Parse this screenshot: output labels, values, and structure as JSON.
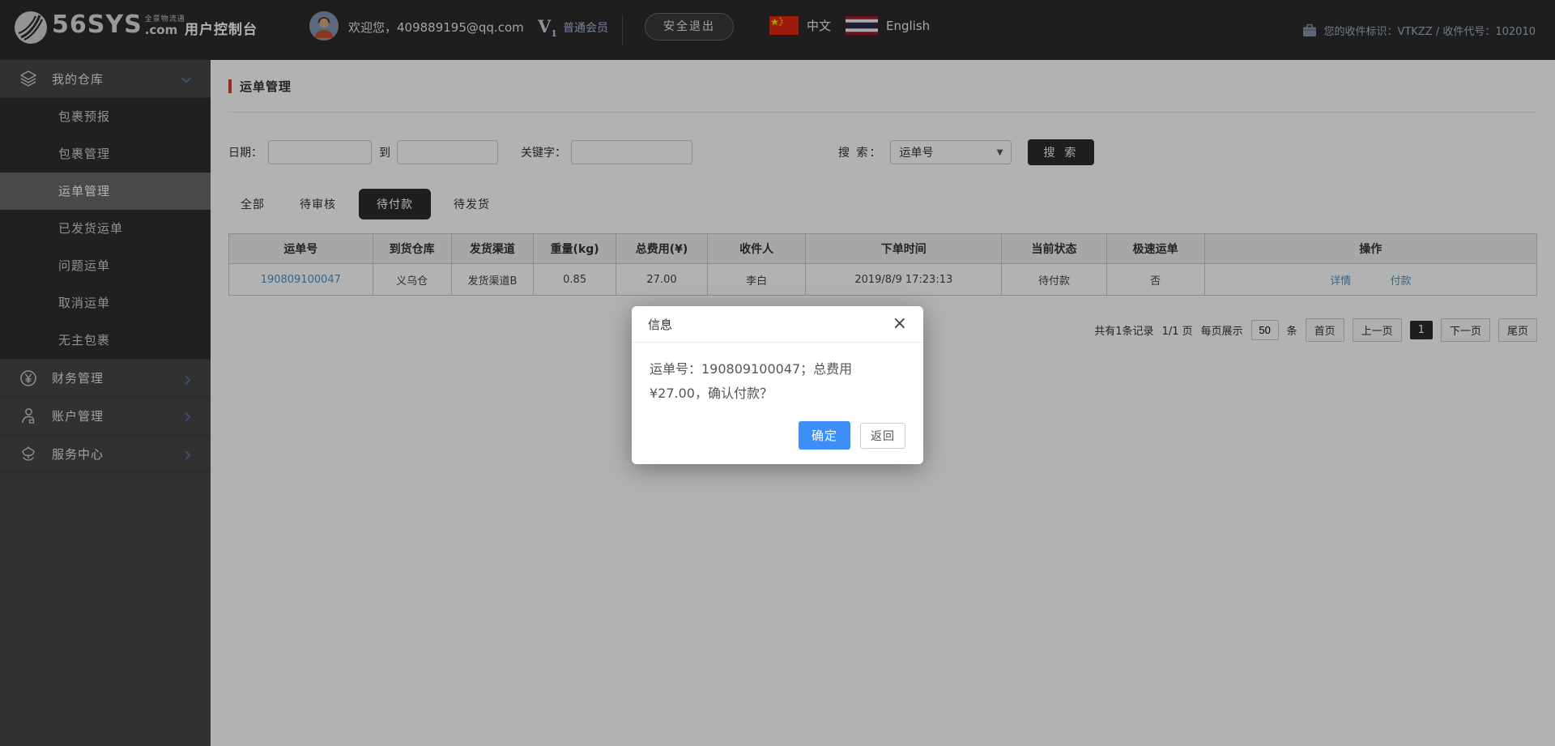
{
  "header": {
    "logo": {
      "brand": "56SYS",
      "suffix": ".com",
      "tagline": "全景物流通"
    },
    "console_title": "用户控制台",
    "welcome": "欢迎您，409889195@qq.com",
    "member": {
      "badge": "V",
      "badge_sub": "1",
      "level": "普通会员"
    },
    "logout_label": "安全退出",
    "languages": [
      {
        "label": "中文"
      },
      {
        "label": "English"
      }
    ],
    "receiver_info": "您的收件标识：VTKZZ / 收件代号：102010"
  },
  "sidebar": {
    "sections": [
      {
        "label": "我的仓库",
        "expanded": true
      },
      {
        "label": "财务管理",
        "expanded": false
      },
      {
        "label": "账户管理",
        "expanded": false
      },
      {
        "label": "服务中心",
        "expanded": false
      }
    ],
    "submenu": [
      {
        "label": "包裹预报",
        "active": false
      },
      {
        "label": "包裹管理",
        "active": false
      },
      {
        "label": "运单管理",
        "active": true
      },
      {
        "label": "已发货运单",
        "active": false
      },
      {
        "label": "问题运单",
        "active": false
      },
      {
        "label": "取消运单",
        "active": false
      },
      {
        "label": "无主包裹",
        "active": false
      }
    ]
  },
  "main": {
    "page_title": "运单管理",
    "filters": {
      "date_label": "日期：",
      "to_label": "到",
      "keyword_label": "关键字：",
      "search_label": "搜 索：",
      "search_type_selected": "运单号",
      "search_arrow": "▼",
      "search_button": "搜 索"
    },
    "tabs": [
      {
        "label": "全部",
        "active": false
      },
      {
        "label": "待审核",
        "active": false
      },
      {
        "label": "待付款",
        "active": true
      },
      {
        "label": "待发货",
        "active": false
      }
    ],
    "table": {
      "headers": [
        "运单号",
        "到货仓库",
        "发货渠道",
        "重量(kg)",
        "总费用(¥)",
        "收件人",
        "下单时间",
        "当前状态",
        "极速运单",
        "操作"
      ],
      "rows": [
        {
          "waybill_no": "190809100047",
          "warehouse": "义乌仓",
          "channel": "发货渠道B",
          "weight": "0.85",
          "total_fee": "27.00",
          "receiver": "李白",
          "order_time": "2019/8/9 17:23:13",
          "status": "待付款",
          "express": "否",
          "actions": [
            "详情",
            "付款"
          ]
        }
      ]
    },
    "pagination": {
      "summary": "共有1条记录",
      "page_info": "1/1 页",
      "per_page_label": "每页展示",
      "per_page_value": "50",
      "per_page_unit": "条",
      "first": "首页",
      "prev": "上一页",
      "current": "1",
      "next": "下一页",
      "last": "尾页"
    }
  },
  "modal": {
    "title": "信息",
    "close": "×",
    "message": "运单号：190809100047；总费用¥27.00，确认付款？",
    "confirm_label": "确定",
    "back_label": "返回"
  },
  "colors": {
    "accent_red": "#d6412f",
    "link_blue": "#4d94cb",
    "primary_blue": "#3e8ef7",
    "dark": "#2b2b2b"
  }
}
